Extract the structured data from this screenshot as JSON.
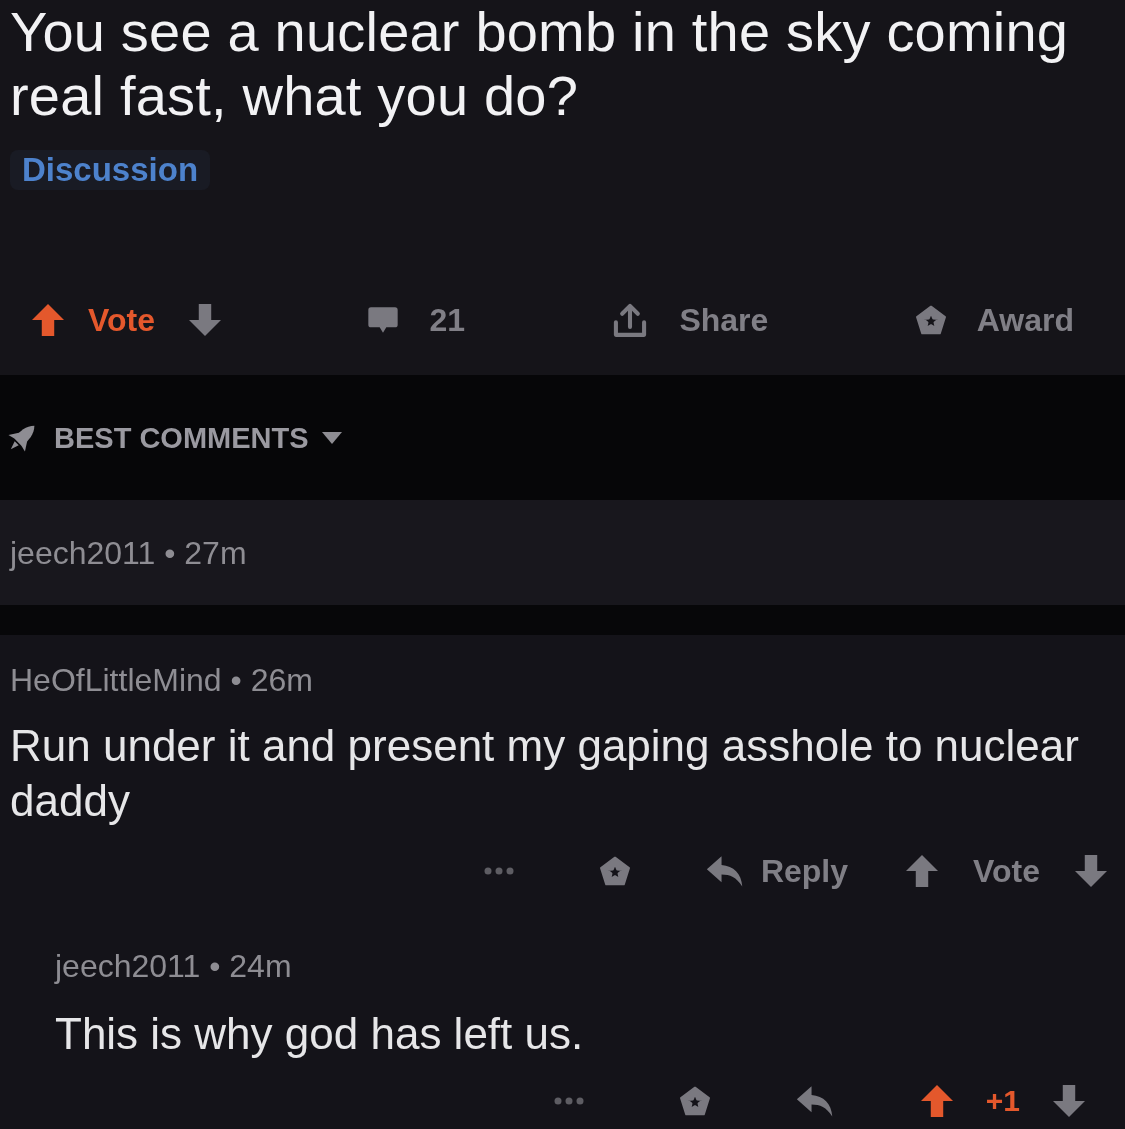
{
  "post": {
    "title": "You see a nuclear bomb in the sky coming real fast, what you do?",
    "flair": "Discussion"
  },
  "action_bar": {
    "upvoted": true,
    "vote_label": "Vote",
    "comment_count": "21",
    "share_label": "Share",
    "award_label": "Award"
  },
  "sort": {
    "label": "BEST COMMENTS"
  },
  "comments": [
    {
      "byline": "jeech2011 • 27m"
    },
    {
      "byline": "HeOfLittleMind • 26m",
      "body": "Run under it and present my gaping asshole to nuclear daddy",
      "actions": {
        "reply_label": "Reply",
        "upvoted": false,
        "vote_label": "Vote"
      },
      "replies": [
        {
          "byline": "jeech2011 • 24m",
          "body": "This is why god has left us.",
          "actions": {
            "upvoted": true,
            "vote_label": "+1"
          }
        }
      ]
    }
  ]
}
